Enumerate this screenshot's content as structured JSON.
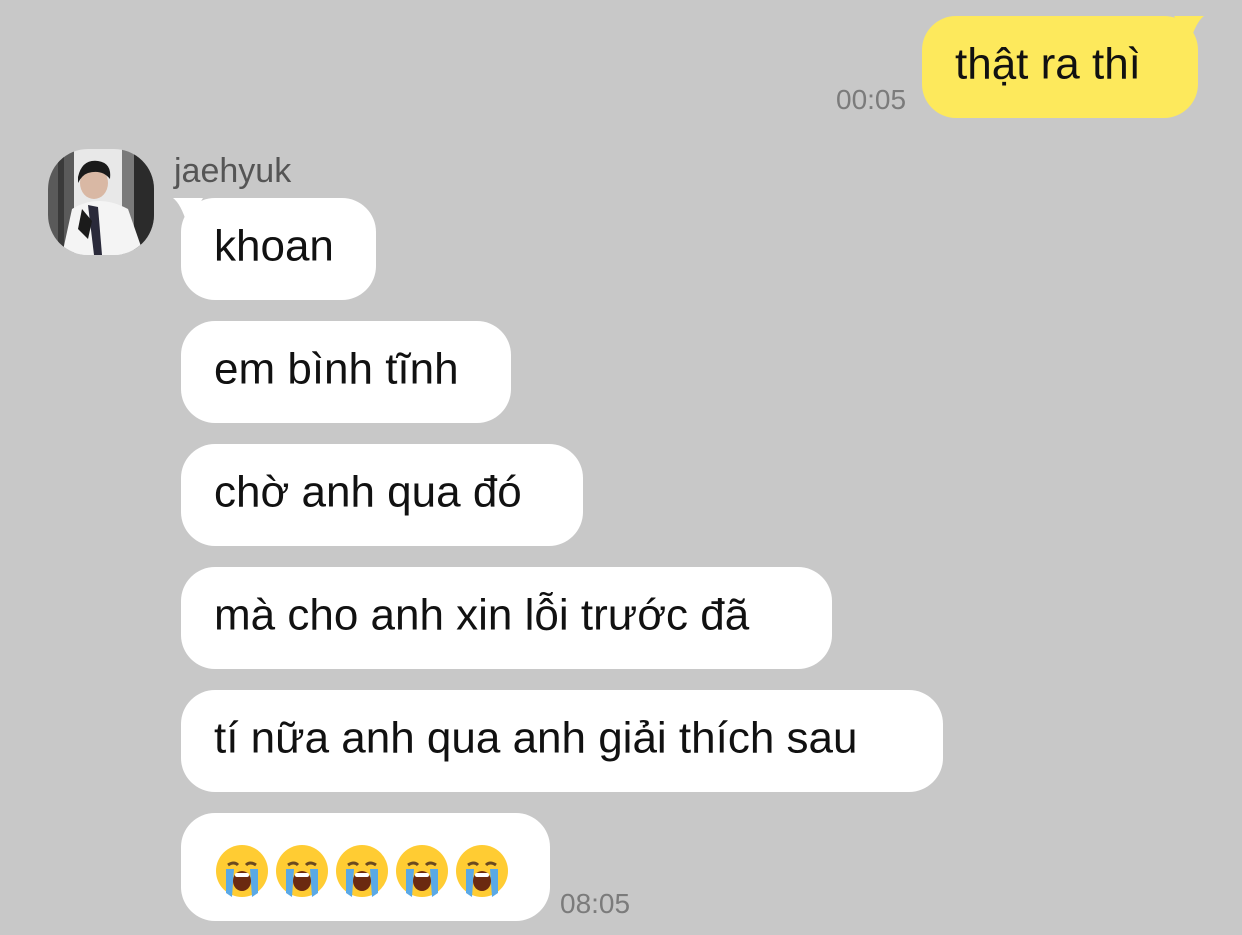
{
  "chat": {
    "outgoing": {
      "text": "thật ra thì",
      "time": "00:05"
    },
    "sender": {
      "name": "jaehyuk",
      "avatar": "profile-photo"
    },
    "incoming": [
      {
        "text": "khoan"
      },
      {
        "text": "em bình tĩnh"
      },
      {
        "text": "chờ anh qua đó"
      },
      {
        "text": "mà cho anh xin lỗi trước đã"
      },
      {
        "text": "tí nữa anh qua anh giải thích sau"
      }
    ],
    "last_message": {
      "emojis": [
        "😭",
        "😭",
        "😭",
        "😭",
        "😭"
      ],
      "time": "08:05"
    }
  },
  "colors": {
    "background": "#c8c8c8",
    "outgoing_bubble": "#fde95c",
    "incoming_bubble": "#ffffff",
    "timestamp": "#7b7b7b"
  },
  "icons": {
    "emoji": "loudly-crying-face-icon"
  }
}
